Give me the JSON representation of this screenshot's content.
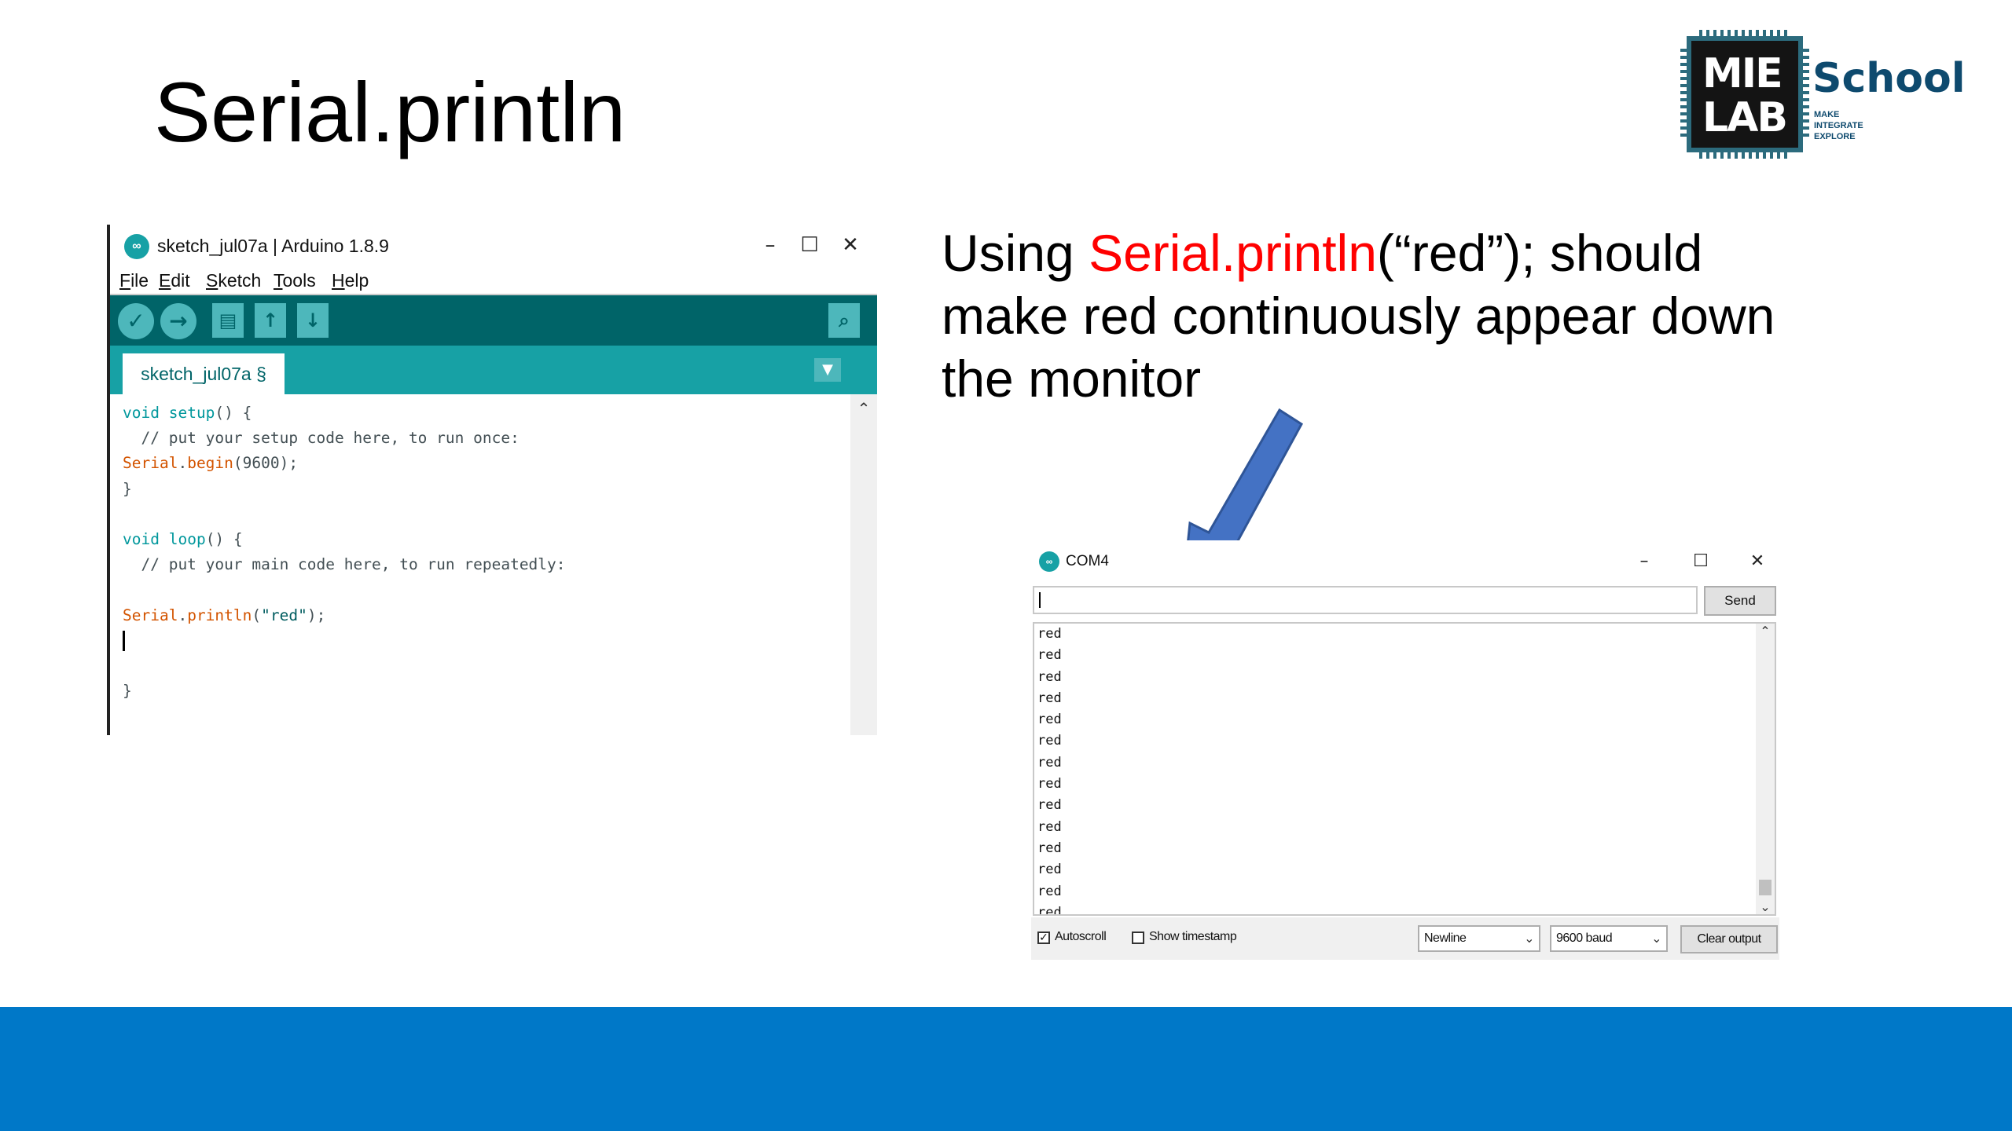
{
  "slide": {
    "title": "Serial.println",
    "instruction": {
      "prefix": "Using ",
      "highlight": "Serial.println",
      "suffix": "(“red”); should make red continuously appear down the monitor"
    },
    "highlight_color": "#ff0000",
    "footer_color": "#0078c8",
    "arrow_color": "#4472c4"
  },
  "logo": {
    "line1": "MIE",
    "line2": "LAB",
    "brand": "School",
    "tagline": [
      "MAKE",
      "INTEGRATE",
      "EXPLORE"
    ]
  },
  "ide": {
    "window_title": "sketch_jul07a | Arduino 1.8.9",
    "window_controls": {
      "minimize": "–",
      "maximize": "☐",
      "close": "✕"
    },
    "menu": [
      "File",
      "Edit",
      "Sketch",
      "Tools",
      "Help"
    ],
    "toolbar_icons": [
      "verify-icon",
      "upload-icon",
      "new-icon",
      "open-icon",
      "save-icon",
      "serial-monitor-icon"
    ],
    "tab_label": "sketch_jul07a §",
    "code_lines": [
      [
        {
          "t": "void",
          "c": "kw"
        },
        {
          "t": " "
        },
        {
          "t": "setup",
          "c": "kw"
        },
        {
          "t": "() {"
        }
      ],
      [
        {
          "t": "  // put your setup code here, to run once:",
          "c": "cmt"
        }
      ],
      [
        {
          "t": "Serial",
          "c": "fn"
        },
        {
          "t": "."
        },
        {
          "t": "begin",
          "c": "fn"
        },
        {
          "t": "(9600);"
        }
      ],
      [
        {
          "t": "}"
        }
      ],
      [
        {
          "t": ""
        }
      ],
      [
        {
          "t": "void",
          "c": "kw"
        },
        {
          "t": " "
        },
        {
          "t": "loop",
          "c": "kw"
        },
        {
          "t": "() {"
        }
      ],
      [
        {
          "t": "  // put your main code here, to run repeatedly:",
          "c": "cmt"
        }
      ],
      [
        {
          "t": ""
        }
      ],
      [
        {
          "t": "Serial",
          "c": "fn"
        },
        {
          "t": "."
        },
        {
          "t": "println",
          "c": "fn"
        },
        {
          "t": "("
        },
        {
          "t": "\"red\"",
          "c": "str"
        },
        {
          "t": ");"
        }
      ],
      [
        {
          "t": "",
          "caret": true
        }
      ],
      [
        {
          "t": ""
        }
      ],
      [
        {
          "t": "}"
        }
      ]
    ]
  },
  "monitor": {
    "window_title": "COM4",
    "input_value": "",
    "send_label": "Send",
    "output_lines": [
      "red",
      "red",
      "red",
      "red",
      "red",
      "red",
      "red",
      "red",
      "red",
      "red",
      "red",
      "red",
      "red",
      "red"
    ],
    "autoscroll": {
      "label": "Autoscroll",
      "checked": true
    },
    "timestamp": {
      "label": "Show timestamp",
      "checked": false
    },
    "line_ending": "Newline",
    "baud": "9600 baud",
    "clear_label": "Clear output"
  }
}
